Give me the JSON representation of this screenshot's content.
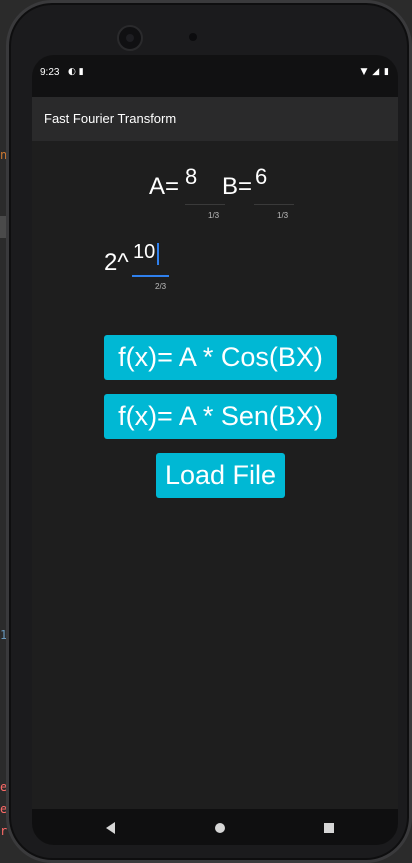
{
  "status_bar": {
    "time": "9:23",
    "left_icons": [
      "data-saver-icon",
      "sd-card-icon"
    ],
    "right_icons": [
      "wifi-icon",
      "signal-icon",
      "battery-icon"
    ]
  },
  "app_bar": {
    "title": "Fast Fourier Transform"
  },
  "inputs": {
    "a": {
      "label": "A=",
      "value": "8",
      "counter": "1/3"
    },
    "b": {
      "label": "B=",
      "value": "6",
      "counter": "1/3"
    },
    "power": {
      "label": "2^",
      "value": "10",
      "counter": "2/3"
    }
  },
  "buttons": {
    "cos": "f(x)= A * Cos(BX)",
    "sen": "f(x)= A * Sen(BX)",
    "load": "Load File"
  },
  "colors": {
    "accent": "#00b8d4",
    "focus": "#2f80ed",
    "background": "#1e1e1e",
    "app_bar": "#2a2a2b"
  },
  "nav_bar": {
    "icons": [
      "back-icon",
      "home-icon",
      "recents-icon"
    ]
  }
}
